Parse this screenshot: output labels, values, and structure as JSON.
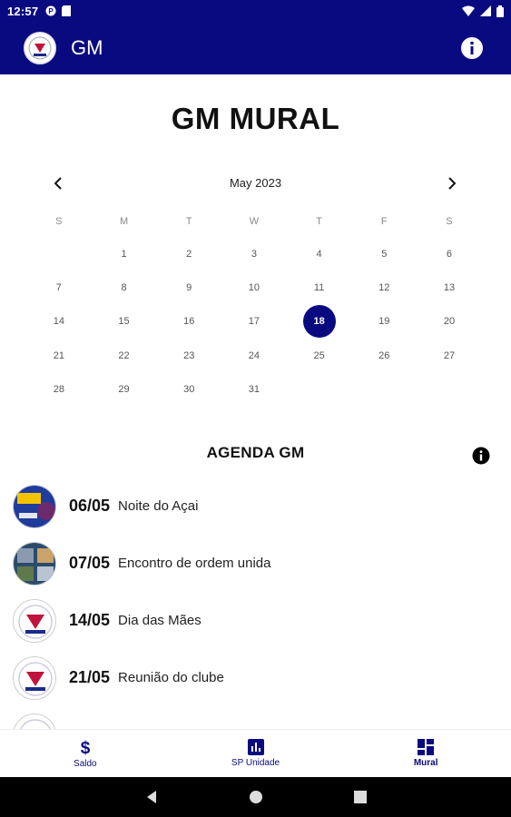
{
  "status_bar": {
    "time": "12:57"
  },
  "app_bar": {
    "title": "GM"
  },
  "page": {
    "title": "GM MURAL"
  },
  "calendar": {
    "month_label": "May 2023",
    "weekdays": [
      "S",
      "M",
      "T",
      "W",
      "T",
      "F",
      "S"
    ],
    "selected_day": "18",
    "weeks": [
      [
        "",
        "1",
        "2",
        "3",
        "4",
        "5",
        "6"
      ],
      [
        "7",
        "8",
        "9",
        "10",
        "11",
        "12",
        "13"
      ],
      [
        "14",
        "15",
        "16",
        "17",
        "18",
        "19",
        "20"
      ],
      [
        "21",
        "22",
        "23",
        "24",
        "25",
        "26",
        "27"
      ],
      [
        "28",
        "29",
        "30",
        "31",
        "",
        "",
        ""
      ]
    ]
  },
  "agenda": {
    "title": "AGENDA GM",
    "items": [
      {
        "date": "06/05",
        "name": "Noite do Açai"
      },
      {
        "date": "07/05",
        "name": "Encontro de ordem unida"
      },
      {
        "date": "14/05",
        "name": "Dia das Mães"
      },
      {
        "date": "21/05",
        "name": "Reunião do clube"
      }
    ]
  },
  "bottom_nav": {
    "items": [
      {
        "label": "Saldo",
        "icon": "dollar-icon"
      },
      {
        "label": "SP Unidade",
        "icon": "bar-chart-icon"
      },
      {
        "label": "Mural",
        "icon": "dashboard-icon"
      }
    ],
    "active": "Mural"
  },
  "colors": {
    "primary": "#0a0a80",
    "background": "#ffffff"
  }
}
